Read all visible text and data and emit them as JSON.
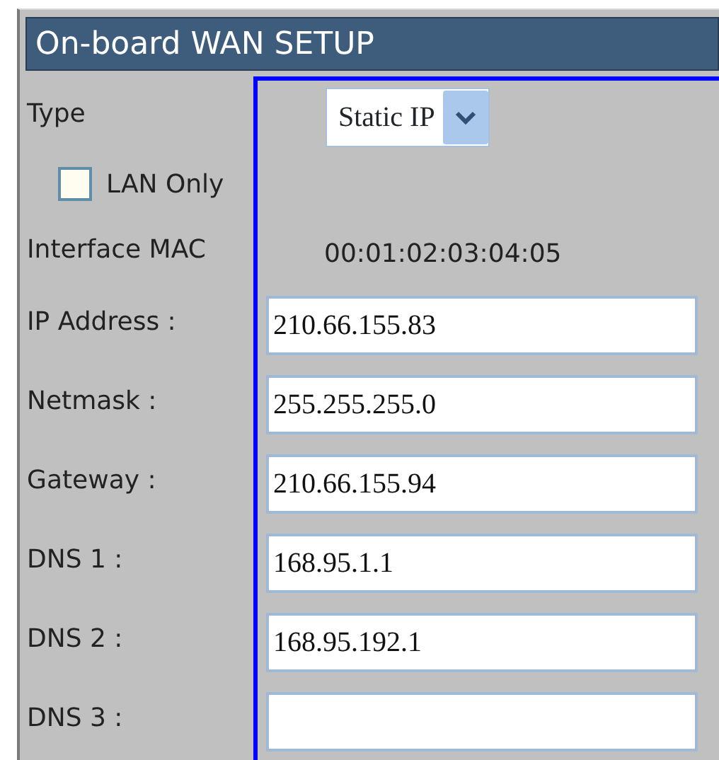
{
  "header": {
    "title": "On-board WAN SETUP"
  },
  "type": {
    "label": "Type",
    "value": "Static IP"
  },
  "lan_only": {
    "label": "LAN Only",
    "checked": false
  },
  "interface_mac": {
    "label": "Interface MAC",
    "value": "00:01:02:03:04:05"
  },
  "fields": [
    {
      "label": "IP Address :",
      "value": "210.66.155.83"
    },
    {
      "label": "Netmask :",
      "value": "255.255.255.0"
    },
    {
      "label": "Gateway :",
      "value": "210.66.155.94"
    },
    {
      "label": "DNS 1 :",
      "value": "168.95.1.1"
    },
    {
      "label": "DNS 2 :",
      "value": "168.95.192.1"
    },
    {
      "label": "DNS 3 :"
    }
  ]
}
